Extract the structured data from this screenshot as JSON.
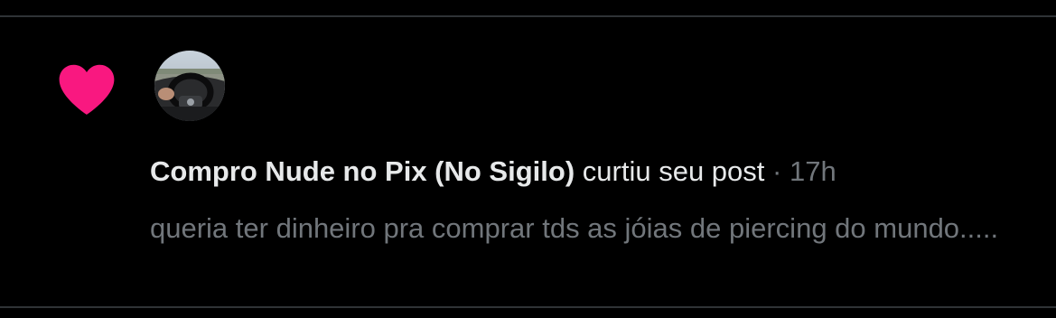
{
  "notification": {
    "type_icon": "heart-icon",
    "icon_color": "#f91880",
    "avatar": "user-avatar",
    "user_name": "Compro Nude no Pix (No Sigilo)",
    "action_text": "curtiu seu post",
    "separator": "·",
    "timestamp": "17h",
    "post_text": "queria ter dinheiro pra comprar tds as jóias de piercing do mundo....."
  },
  "colors": {
    "background": "#000000",
    "primary_text": "#e7e9ea",
    "secondary_text": "#71767b",
    "divider": "#2f3336",
    "like_pink": "#f91880"
  }
}
